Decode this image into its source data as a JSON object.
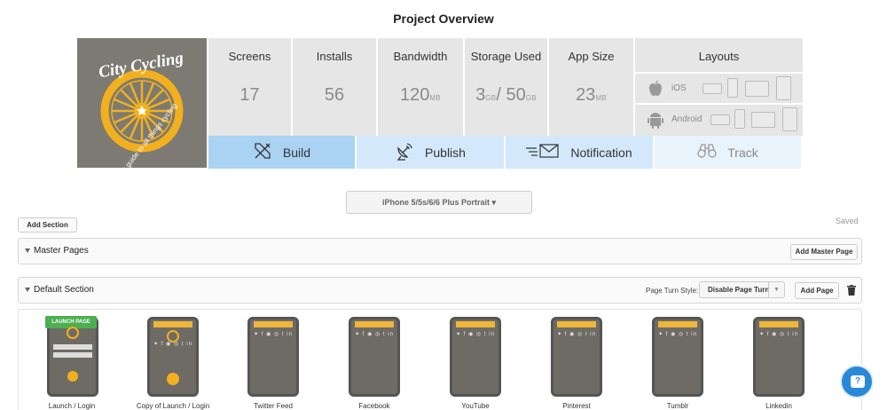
{
  "page_title": "Project Overview",
  "logo": {
    "name": "City Cycling",
    "tagline": "your guide to all things cycling"
  },
  "stats": [
    {
      "label": "Screens",
      "value": "17",
      "unit": ""
    },
    {
      "label": "Installs",
      "value": "56",
      "unit": ""
    },
    {
      "label": "Bandwidth",
      "value": "120",
      "unit": "MB"
    },
    {
      "label": "Storage Used",
      "value": "3",
      "unit": "GB",
      "value2": "/ 50",
      "unit2": "GB"
    },
    {
      "label": "App Size",
      "value": "23",
      "unit": "MB"
    }
  ],
  "layouts": {
    "label": "Layouts",
    "ios": "iOS",
    "android": "Android"
  },
  "actions": {
    "build": "Build",
    "publish": "Publish",
    "notification": "Notification",
    "track": "Track"
  },
  "device_select": "iPhone 5/5s/6/6 Plus Portrait ▾",
  "add_section": "Add Section",
  "status_saved": "Saved",
  "master": {
    "title": "Master Pages",
    "add_button": "Add Master Page"
  },
  "default_section": {
    "title": "Default Section",
    "page_turn_label": "Page Turn Style:",
    "page_turn_value": "Disable Page Turn",
    "add_page_button": "Add Page"
  },
  "pages": [
    {
      "label": "Launch / Login",
      "badge": "LAUNCH PAGE"
    },
    {
      "label": "Copy of Launch / Login"
    },
    {
      "label": "Twitter Feed"
    },
    {
      "label": "Facebook"
    },
    {
      "label": "YouTube"
    },
    {
      "label": "Pinterest"
    },
    {
      "label": "Tumblr"
    },
    {
      "label": "Linkedin"
    }
  ],
  "help_icon": "?",
  "colors": {
    "build_bg": "#a9d2f3",
    "publish_bg": "#d3e9fb",
    "logo_bg": "#7c7a72",
    "help_bg": "#2a88d8"
  }
}
